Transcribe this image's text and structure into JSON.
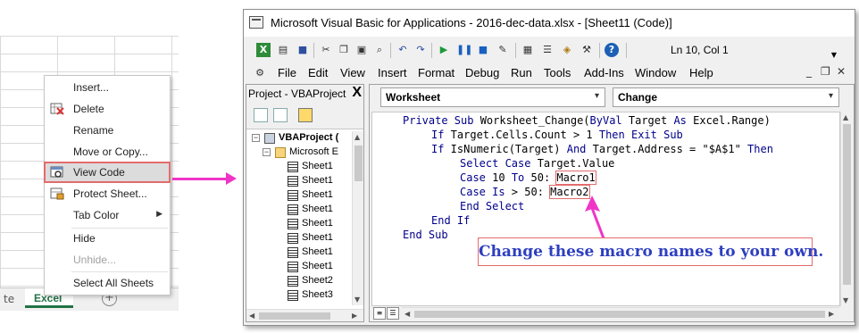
{
  "excel": {
    "tab_partial": "te",
    "active_tab": "Excel",
    "add_sheet_glyph": "+"
  },
  "context_menu": {
    "items": [
      {
        "label": "Insert...",
        "icon": ""
      },
      {
        "label": "Delete",
        "icon": "delete-sheet-icon"
      },
      {
        "label": "Rename",
        "icon": ""
      },
      {
        "label": "Move or Copy...",
        "icon": ""
      },
      {
        "label": "View Code",
        "icon": "view-code-icon"
      },
      {
        "label": "Protect Sheet...",
        "icon": "protect-sheet-icon"
      },
      {
        "label": "Tab Color",
        "icon": ""
      },
      {
        "label": "Hide",
        "icon": ""
      },
      {
        "label": "Unhide...",
        "icon": ""
      },
      {
        "label": "Select All Sheets",
        "icon": ""
      }
    ],
    "highlight_color": "#e36b6b"
  },
  "vba": {
    "title": "Microsoft Visual Basic for Applications - 2016-dec-data.xlsx - [Sheet11 (Code)]",
    "status": "Ln 10, Col 1",
    "menu": [
      "File",
      "Edit",
      "View",
      "Insert",
      "Format",
      "Debug",
      "Run",
      "Tools",
      "Add-Ins",
      "Window",
      "Help"
    ],
    "project": {
      "title": "Project - VBAProject",
      "close_glyph": "X",
      "root": "VBAProject (",
      "folder": "Microsoft E",
      "sheets": [
        "Sheet1",
        "Sheet1",
        "Sheet1",
        "Sheet1",
        "Sheet1",
        "Sheet1",
        "Sheet1",
        "Sheet1",
        "Sheet1",
        "Sheet1",
        "Sheet2",
        "Sheet3"
      ]
    },
    "object_combo": "Worksheet",
    "proc_combo": "Change",
    "code": {
      "l1_a": "Private Sub",
      "l1_b": " Worksheet_Change(",
      "l1_c": "ByVal",
      "l1_d": " Target ",
      "l1_e": "As",
      "l1_f": " Excel.Range)",
      "l2_a": "If",
      "l2_b": " Target.Cells.Count > 1 ",
      "l2_c": "Then Exit Sub",
      "l3_a": "If",
      "l3_b": " IsNumeric(Target) ",
      "l3_c": "And",
      "l3_d": " Target.Address = \"$A$1\" ",
      "l3_e": "Then",
      "l4_a": "Select Case",
      "l4_b": " Target.Value",
      "l5_a": "Case",
      "l5_b": " 10 ",
      "l5_c": "To",
      "l5_d": " 50: ",
      "l5_macro": "Macro1",
      "l6_a": "Case Is",
      "l6_b": " > 50: ",
      "l6_macro": "Macro2",
      "l7": "End Select",
      "l8": "End If",
      "l9": "End Sub"
    },
    "callout": "Change these macro names to your own."
  },
  "colors": {
    "arrow": "#ef35c8",
    "keyword": "#00008b",
    "callout_text": "#2e3fbf",
    "excel_green": "#217346"
  }
}
